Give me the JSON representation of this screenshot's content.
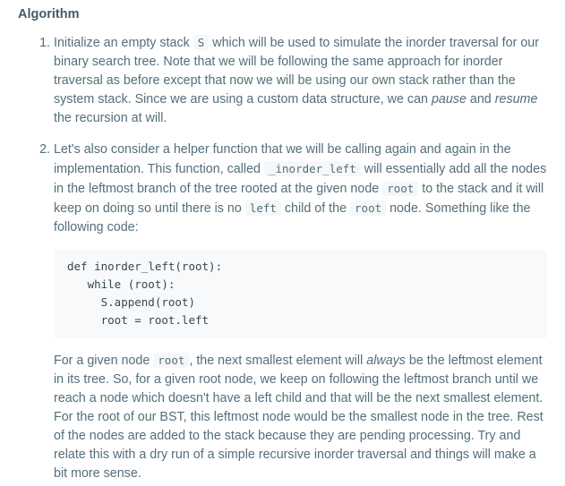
{
  "heading": "Algorithm",
  "step1": {
    "t1": "Initialize an empty stack ",
    "c1": "S",
    "t2": " which will be used to simulate the inorder traversal for our binary search tree. Note that we will be following the same approach for inorder traversal as before except that now we will be using our own stack rather than the system stack. Since we are using a custom data structure, we can ",
    "em1": "pause",
    "t3": " and ",
    "em2": "resume",
    "t4": " the recursion at will."
  },
  "step2": {
    "t1": "Let's also consider a helper function that we will be calling again and again in the implementation. This function, called ",
    "c1": "_inorder_left",
    "t2": " will essentially add all the nodes in the leftmost branch of the tree rooted at the given node ",
    "c2": "root",
    "t3": " to the stack and it will keep on doing so until there is no ",
    "c3": "left",
    "t4": " child of the ",
    "c4": "root",
    "t5": " node. Something like the following code:",
    "code_lines": [
      "def inorder_left(root):",
      "   while (root):",
      "     S.append(root)",
      "     root = root.left"
    ],
    "p2": {
      "t1": "For a given node ",
      "c1": "root",
      "t2": ", the next smallest element will ",
      "em1": "always",
      "t3": " be the leftmost element in its tree. So, for a given root node, we keep on following the leftmost branch until we reach a node which doesn't have a left child and that will be the next smallest element. For the root of our BST, this leftmost node would be the smallest node in the tree. Rest of the nodes are added to the stack because they are pending processing. Try and relate this with a dry run of a simple recursive inorder traversal and things will make a bit more sense."
    }
  }
}
